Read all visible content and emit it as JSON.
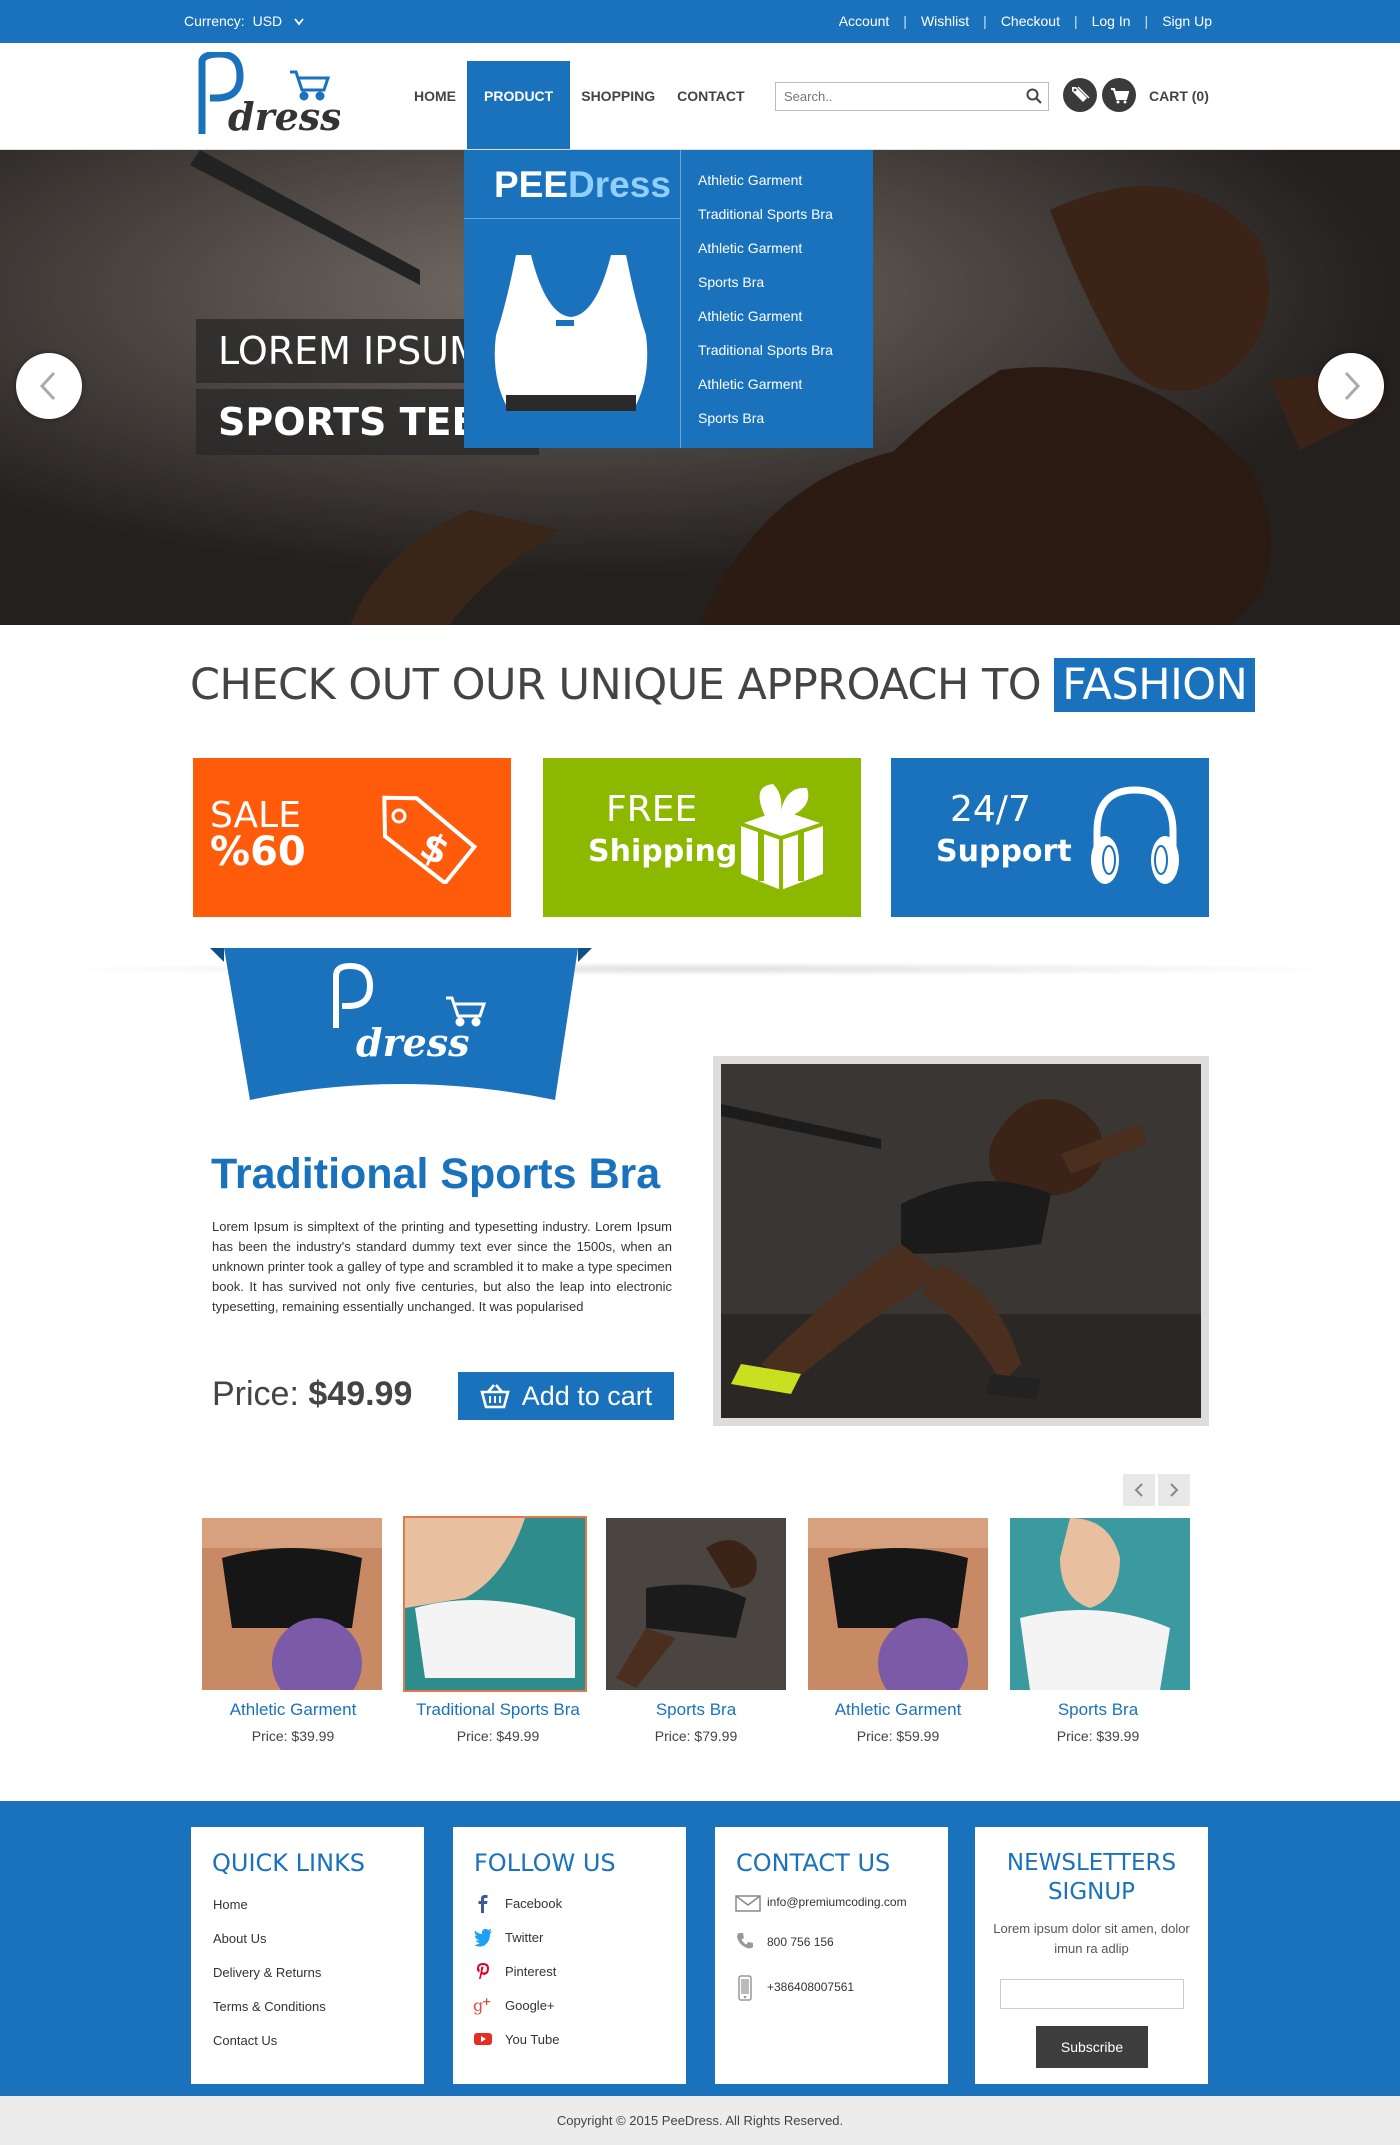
{
  "topbar": {
    "currency_label": "Currency:",
    "currency_value": "USD",
    "links": [
      "Account",
      "Wishlist",
      "Checkout",
      "Log In",
      "Sign Up"
    ]
  },
  "header": {
    "logo_text": "dress",
    "nav": [
      "HOME",
      "PRODUCT",
      "SHOPPING",
      "CONTACT"
    ],
    "active_nav": "PRODUCT",
    "search_placeholder": "Search..",
    "cart_label": "CART (0)"
  },
  "dropdown": {
    "brand_part1": "PEE",
    "brand_part2": "Dress",
    "items": [
      "Athletic Garment",
      "Traditional Sports Bra",
      "Athletic Garment",
      "Sports Bra",
      "Athletic Garment",
      "Traditional Sports Bra",
      "Athletic Garment",
      "Sports Bra"
    ]
  },
  "hero": {
    "line1": "LOREM IPSUM",
    "line2": "SPORTS TEE E"
  },
  "approach": {
    "text": "CHECK OUT OUR UNIQUE APPROACH TO",
    "highlight": "FASHION"
  },
  "features": [
    {
      "line1": "SALE",
      "line2": "%60",
      "color": "#ff5b0b",
      "icon": "price-tag-icon"
    },
    {
      "line1": "FREE",
      "line2": "Shipping",
      "color": "#8db800",
      "icon": "gift-box-icon"
    },
    {
      "line1": "24/7",
      "line2": "Support",
      "color": "#1a72bd",
      "icon": "headphones-icon"
    }
  ],
  "product": {
    "title": "Traditional Sports Bra",
    "description": "Lorem Ipsum is simpltext of the printing and typesetting industry. Lorem Ipsum has been the industry's standard dummy text ever since the 1500s, when an unknown printer took a galley of type and scrambled it to make a type specimen book. It has survived not only five centuries, but also the leap into electronic typesetting, remaining essentially unchanged. It was popularised",
    "price_label": "Price:",
    "price_value": "$49.99",
    "add_to_cart": "Add to cart"
  },
  "carousel": [
    {
      "name": "Athletic Garment",
      "price": "Price: $39.99"
    },
    {
      "name": "Traditional Sports Bra",
      "price": "Price: $49.99"
    },
    {
      "name": "Sports Bra",
      "price": "Price: $79.99"
    },
    {
      "name": "Athletic Garment",
      "price": "Price: $59.99"
    },
    {
      "name": "Sports Bra",
      "price": "Price: $39.99"
    }
  ],
  "footer": {
    "quick_links": {
      "title": "QUICK LINKS",
      "items": [
        "Home",
        "About Us",
        "Delivery & Returns",
        "Terms & Conditions",
        "Contact Us"
      ]
    },
    "follow_us": {
      "title": "FOLLOW US",
      "items": [
        "Facebook",
        "Twitter",
        "Pinterest",
        "Google+",
        "You Tube"
      ]
    },
    "contact_us": {
      "title": "CONTACT US",
      "email": "info@premiumcoding.com",
      "phone": "800 756 156",
      "mobile": "+386408007561"
    },
    "newsletter": {
      "title_line1": "NEWSLETTERS",
      "title_line2": "SIGNUP",
      "text": "Lorem ipsum dolor sit amen, dolor imun ra adlip",
      "input_value": "",
      "button": "Subscribe"
    },
    "copyright": "Copyright © 2015 PeeDress. All Rights Reserved."
  },
  "colors": {
    "brand": "#1a72bd",
    "orange": "#ff5b0b",
    "green": "#8db800"
  }
}
